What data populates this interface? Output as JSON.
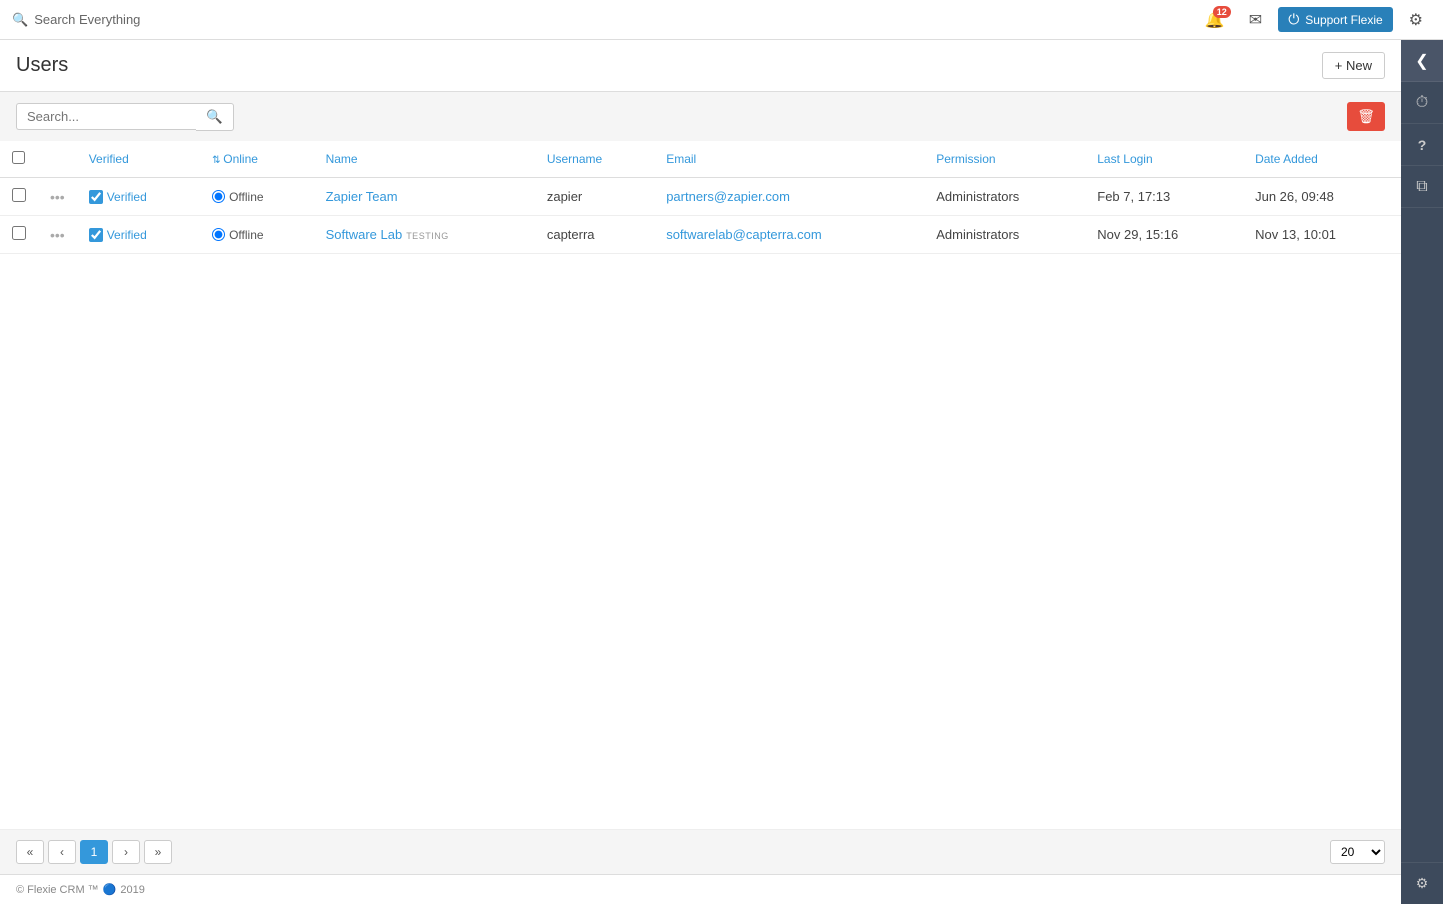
{
  "app": {
    "title": "Search Everything",
    "support_label": "Support Flexie",
    "notification_count": "12"
  },
  "page": {
    "title": "Users",
    "new_button": "+ New"
  },
  "search": {
    "placeholder": "Search...",
    "button_label": "🔍"
  },
  "table": {
    "columns": [
      {
        "key": "verified",
        "label": "Verified"
      },
      {
        "key": "online",
        "label": "Online",
        "sort": true
      },
      {
        "key": "name",
        "label": "Name"
      },
      {
        "key": "username",
        "label": "Username"
      },
      {
        "key": "email",
        "label": "Email"
      },
      {
        "key": "permission",
        "label": "Permission"
      },
      {
        "key": "last_login",
        "label": "Last Login"
      },
      {
        "key": "date_added",
        "label": "Date Added"
      }
    ],
    "rows": [
      {
        "verified": true,
        "verified_label": "Verified",
        "online": false,
        "online_label": "Offline",
        "name": "Zapier Team",
        "name_badge": "",
        "username": "zapier",
        "email": "partners@zapier.com",
        "permission": "Administrators",
        "last_login": "Feb 7, 17:13",
        "date_added": "Jun 26, 09:48"
      },
      {
        "verified": true,
        "verified_label": "Verified",
        "online": false,
        "online_label": "Offline",
        "name": "Software Lab",
        "name_badge": "TESTING",
        "username": "capterra",
        "email": "softwarelab@capterra.com",
        "permission": "Administrators",
        "last_login": "Nov 29, 15:16",
        "date_added": "Nov 13, 10:01"
      }
    ]
  },
  "pagination": {
    "current_page": 1,
    "page_size": "20",
    "pages": [
      1
    ]
  },
  "footer": {
    "copyright": "© Flexie CRM ™",
    "year": "2019"
  },
  "sidebar": {
    "icons": [
      {
        "name": "chevron-left-icon",
        "symbol": "❮"
      },
      {
        "name": "clock-icon",
        "symbol": "⏱"
      },
      {
        "name": "question-icon",
        "symbol": "?"
      },
      {
        "name": "layers-icon",
        "symbol": "⧉"
      }
    ],
    "bottom_icon": {
      "name": "settings-icon",
      "symbol": "⚙"
    }
  }
}
